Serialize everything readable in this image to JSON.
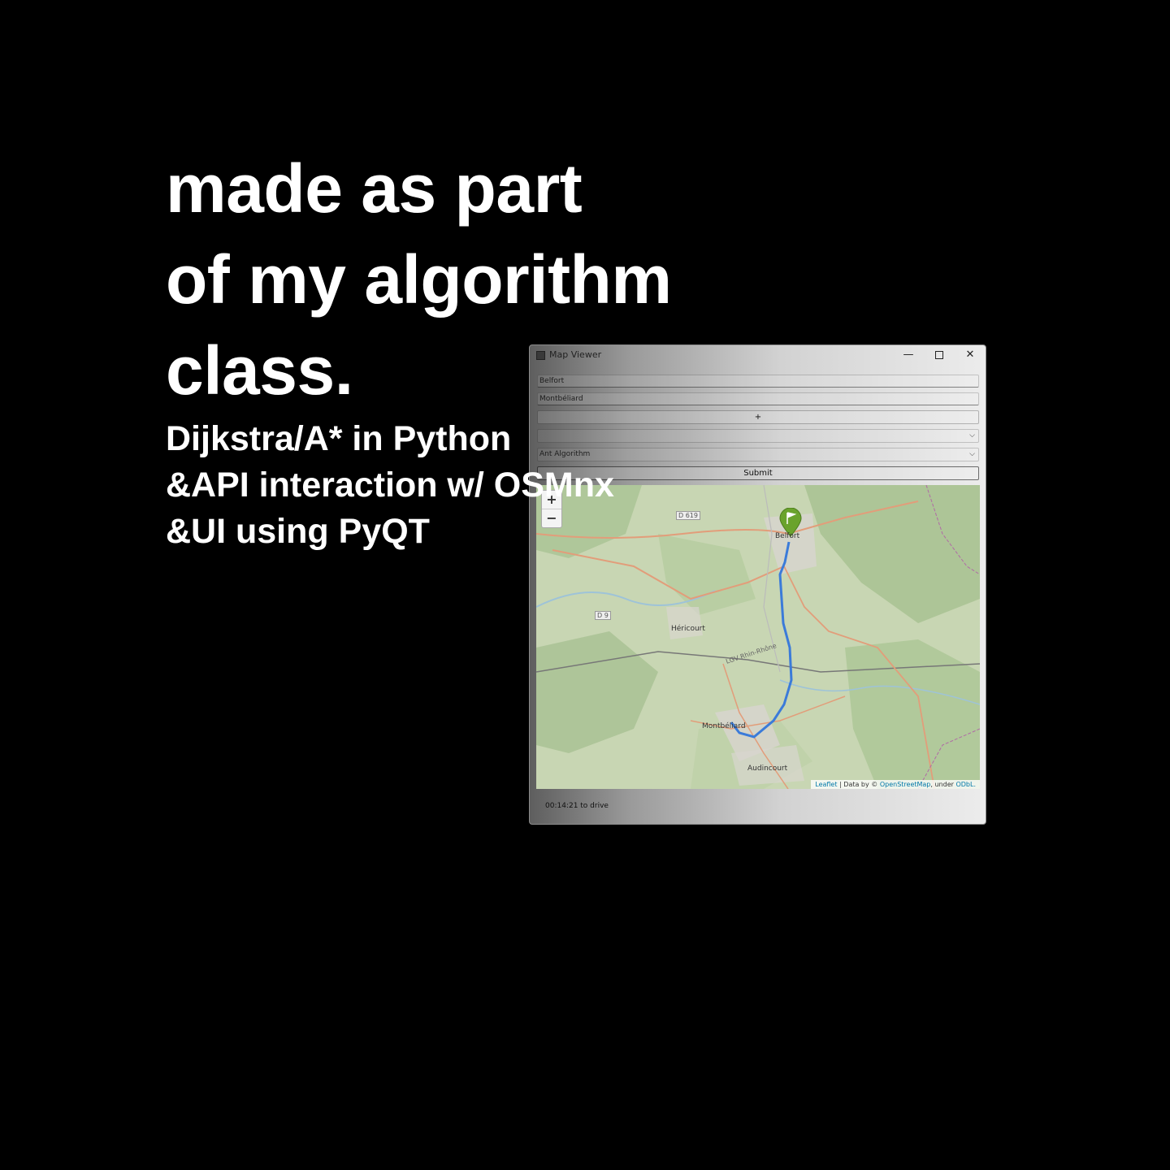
{
  "headline": {
    "line1": "made as part",
    "line2": "of my algorithm",
    "line3": "class."
  },
  "subline": {
    "line1": "Dijkstra/A* in Python",
    "line2": "&API interaction w/ OSMnx",
    "line3": "&UI using PyQT"
  },
  "window": {
    "title": "Map Viewer",
    "minimize_glyph": "—",
    "close_glyph": "✕",
    "origin_value": "Belfort",
    "destination_value": "Montbéliard",
    "add_label": "+",
    "select_1_value": "",
    "algorithm_value": "Ant Algorithm",
    "submit_label": "Submit",
    "status_text": "00:14:21 to drive"
  },
  "map": {
    "zoom_in": "+",
    "zoom_out": "−",
    "places": {
      "belfort": "Belfort",
      "hericourt": "Héricourt",
      "montbeliard": "Montbéliard",
      "audincourt": "Audincourt"
    },
    "roads": {
      "d619": "D 619",
      "d9": "D 9",
      "lgv": "LGV Rhin-Rhône"
    },
    "attribution": {
      "leaflet": "Leaflet",
      "data_by": " | Data by © ",
      "osm": "OpenStreetMap",
      "under": ", under ",
      "odbl": "ODbL."
    },
    "route_color": "#3b7bd9",
    "marker_color": "#6aa32c"
  },
  "icons": {
    "app": "app-icon",
    "minimize": "minimize-icon",
    "maximize": "maximize-icon",
    "close": "close-icon",
    "chevron": "chevron-down-icon",
    "flag_marker": "flag-marker-icon"
  }
}
